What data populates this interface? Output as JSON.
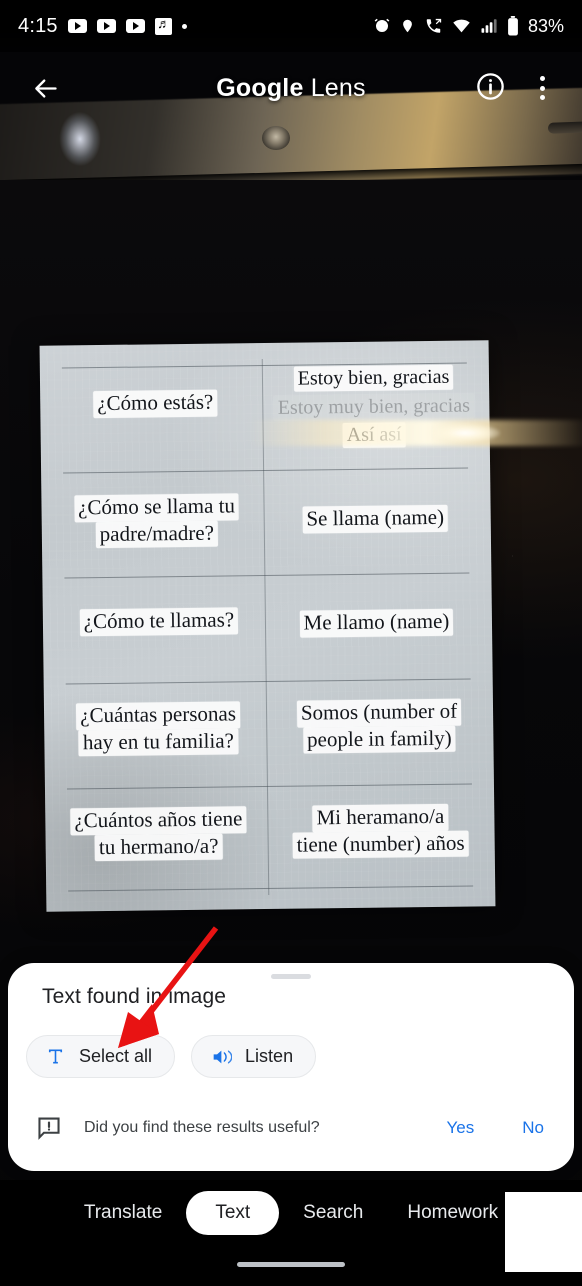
{
  "status_bar": {
    "time": "4:15",
    "left_icons": [
      "youtube-icon",
      "youtube-icon",
      "youtube-icon",
      "youtube-music-icon",
      "dot-indicator"
    ],
    "right_icons": [
      "alarm-icon",
      "location-icon",
      "call-forwarding-icon",
      "wifi-icon",
      "cellular-signal-icon",
      "battery-icon"
    ],
    "battery_percent": "83%"
  },
  "app_bar": {
    "back_label": "back-arrow",
    "title_bold": "Google",
    "title_regular": " Lens",
    "info_label": "info",
    "menu_label": "more-options"
  },
  "document": {
    "rows": [
      {
        "left": [
          "¿Cómo estás?"
        ],
        "right": [
          "Estoy bien, gracias",
          "Estoy muy bien, gracias",
          "Así así"
        ]
      },
      {
        "left": [
          "¿Cómo se llama tu",
          "padre/madre?"
        ],
        "right": [
          "Se llama (name)"
        ]
      },
      {
        "left": [
          "¿Cómo te llamas?"
        ],
        "right": [
          "Me llamo (name)"
        ]
      },
      {
        "left": [
          "¿Cuántas personas",
          "hay en tu familia?"
        ],
        "right": [
          "Somos (number of",
          "people in family)"
        ]
      },
      {
        "left": [
          "¿Cuántos años tiene",
          "tu hermano/a?"
        ],
        "right": [
          "Mi heramano/a",
          "tiene (number) años"
        ]
      }
    ]
  },
  "sheet": {
    "title": "Text found in image",
    "chips": [
      {
        "label": "Select all",
        "icon": "text-select-icon"
      },
      {
        "label": "Listen",
        "icon": "speaker-icon"
      }
    ],
    "feedback": {
      "icon": "feedback-icon",
      "question": "Did you find these results useful?",
      "yes": "Yes",
      "no": "No"
    }
  },
  "bottom_nav": {
    "items": [
      {
        "label": "Translate",
        "active": false
      },
      {
        "label": "Text",
        "active": true
      },
      {
        "label": "Search",
        "active": false
      },
      {
        "label": "Homework",
        "active": false
      }
    ]
  },
  "annotation": {
    "type": "arrow",
    "color": "#e81313",
    "points_to": "Select all"
  },
  "colors": {
    "accent_blue": "#1a73e8",
    "sheet_bg": "#ffffff",
    "nav_bg": "#000000",
    "annotation_red": "#e81313"
  }
}
